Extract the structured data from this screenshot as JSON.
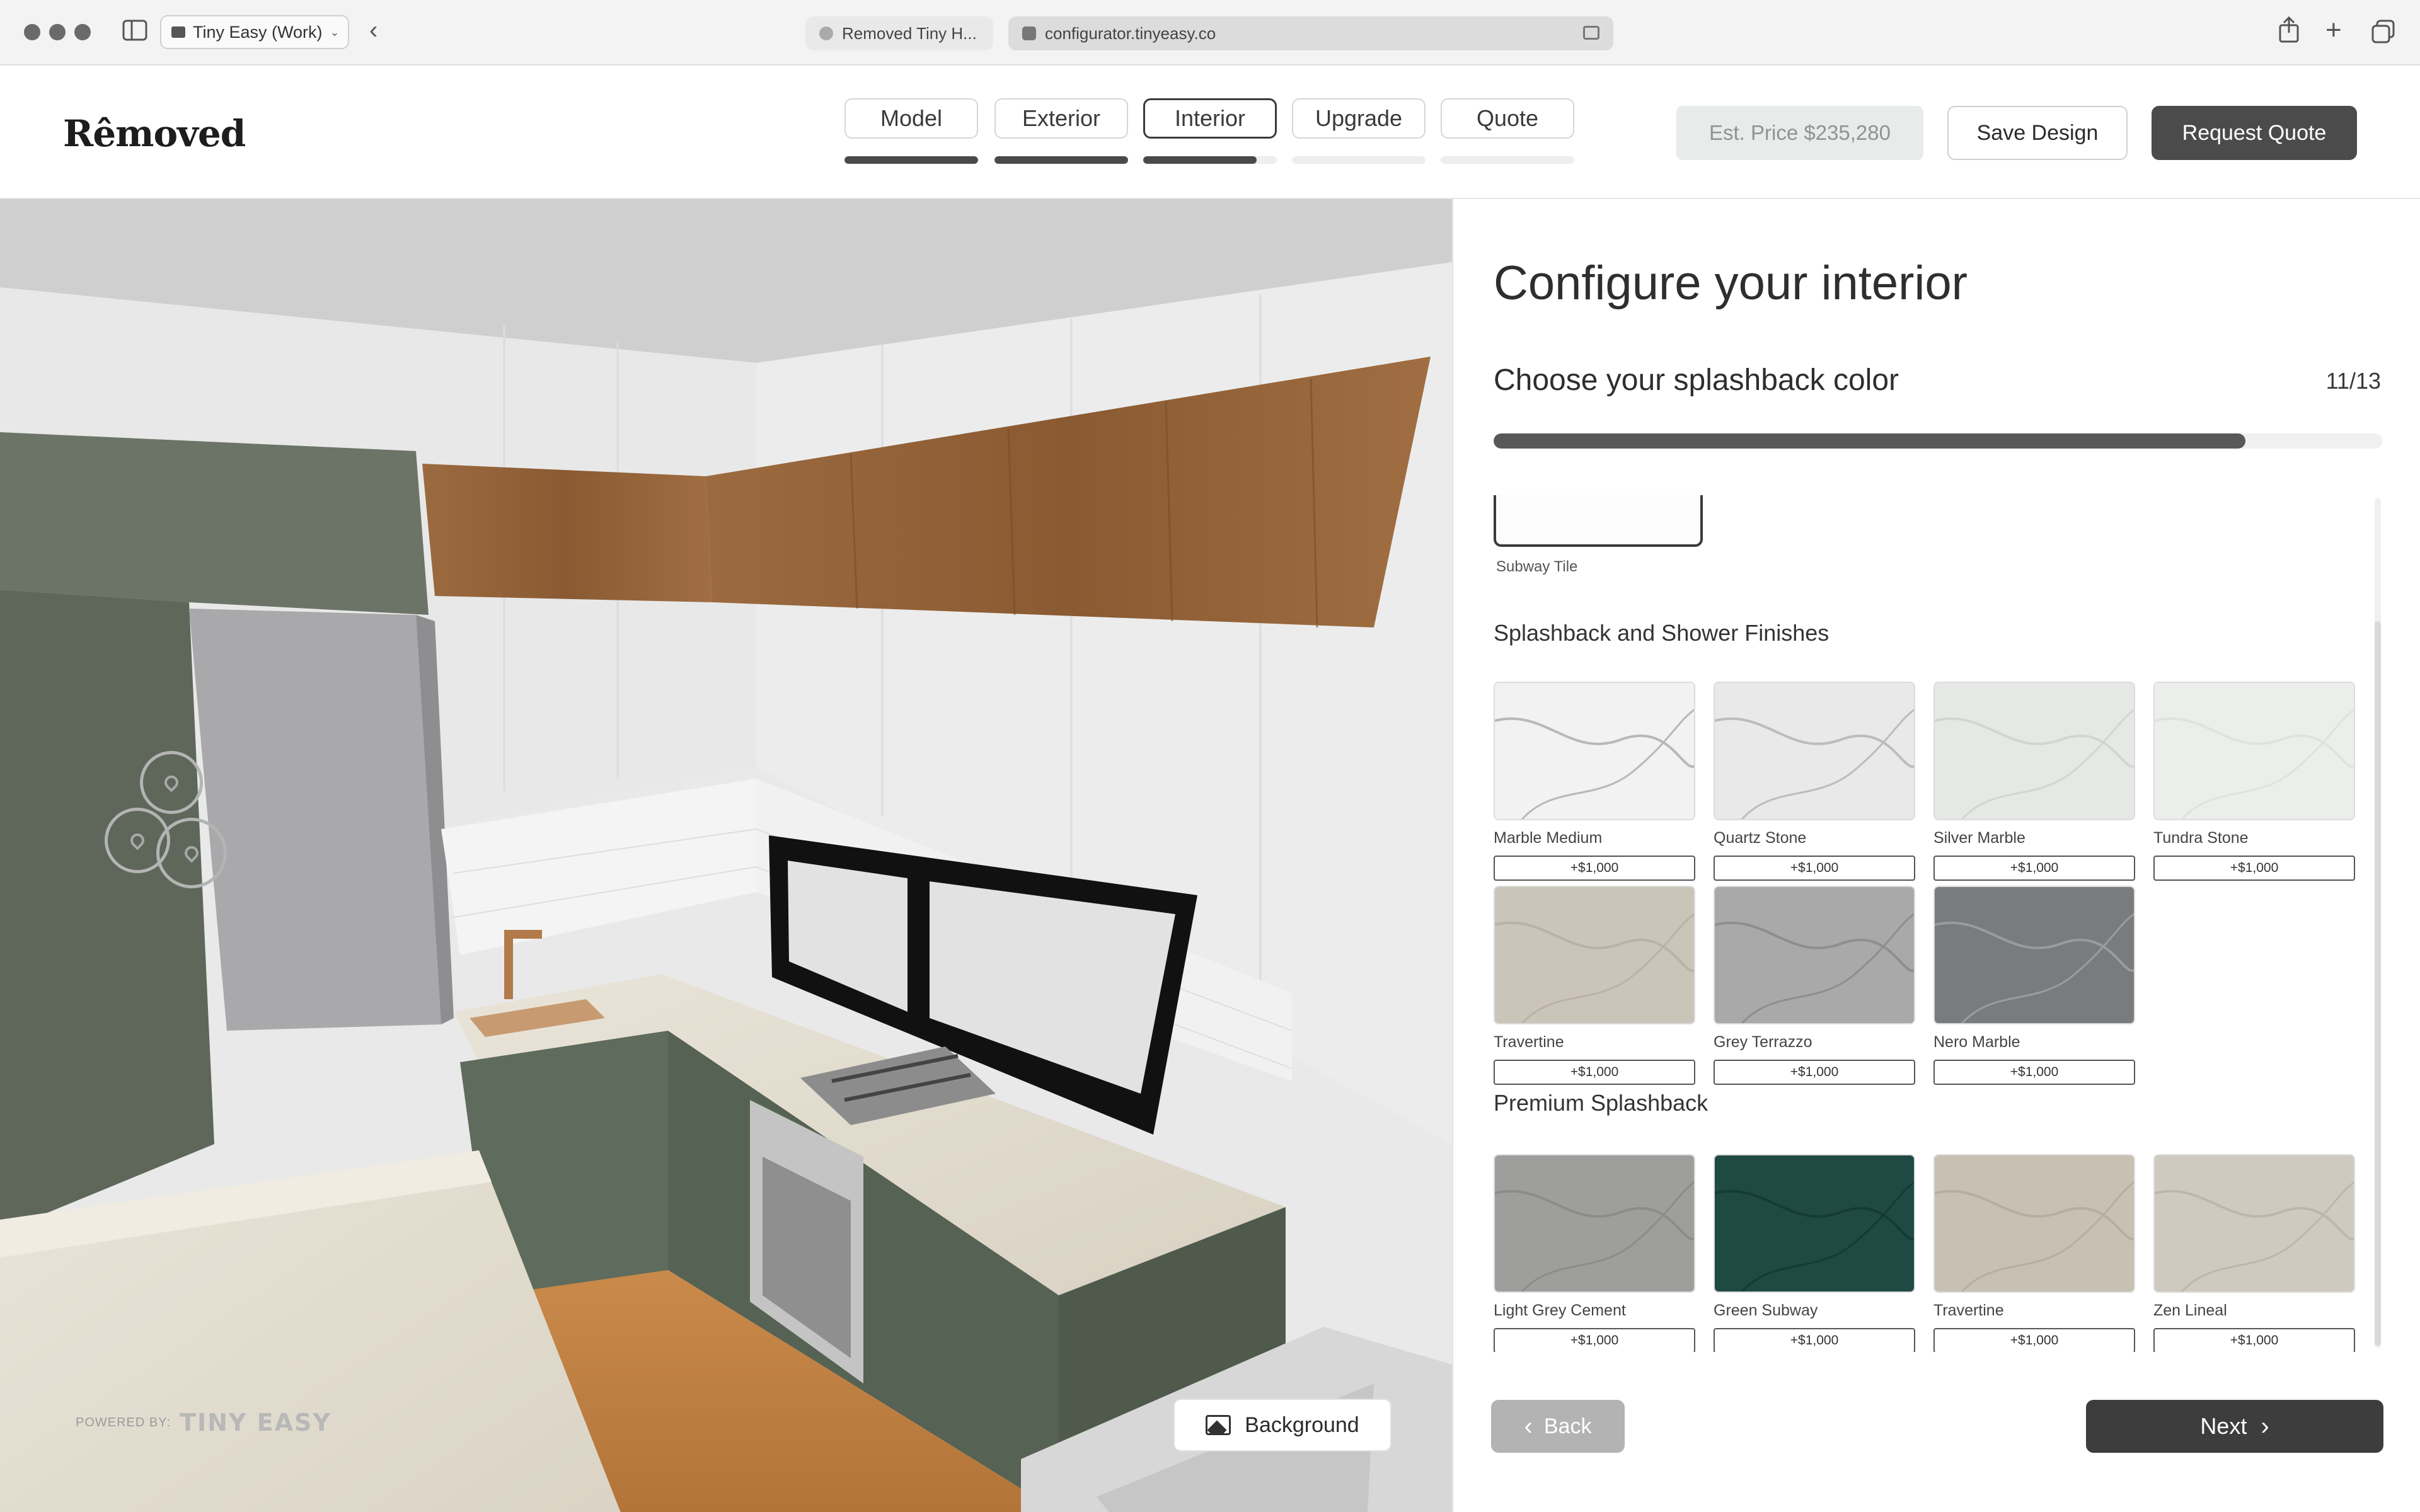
{
  "browser": {
    "profile_label": "Tiny Easy (Work)",
    "tabs": [
      {
        "label": "Removed Tiny H..."
      },
      {
        "label": "configurator.tinyeasy.co"
      }
    ],
    "icons": {
      "sidebar": "sidebar-icon",
      "back": "chevron-left-icon",
      "share": "share-icon",
      "new_tab": "plus-icon",
      "tab_overview": "tabs-icon"
    }
  },
  "header": {
    "logo": "Rêmoved",
    "steps": [
      {
        "label": "Model",
        "progress": 1.0
      },
      {
        "label": "Exterior",
        "progress": 1.0
      },
      {
        "label": "Interior",
        "progress": 0.85
      },
      {
        "label": "Upgrade",
        "progress": 0.0
      },
      {
        "label": "Quote",
        "progress": 0.0
      }
    ],
    "active_step": "Interior",
    "price": "Est. Price $235,280",
    "save_label": "Save Design",
    "quote_label": "Request Quote"
  },
  "preview": {
    "powered_by": "POWERED BY:",
    "powered_brand": "TINY EASY",
    "background_label": "Background",
    "hotspot_count": 3
  },
  "panel": {
    "title": "Configure your interior",
    "question": "Choose your splashback color",
    "step_count": "11/13",
    "progress": 0.846,
    "selected_partial": {
      "name": "Subway Tile"
    },
    "sections": [
      {
        "heading": "Splashback and Shower Finishes",
        "items": [
          {
            "name": "Marble Medium",
            "price": "+$1,000",
            "color": "#f2f2f2",
            "vein": "#b8b8b8"
          },
          {
            "name": "Quartz Stone",
            "price": "+$1,000",
            "color": "#e9e9e9",
            "vein": "#bcbcbc"
          },
          {
            "name": "Silver Marble",
            "price": "+$1,000",
            "color": "#e6e8e6",
            "vein": "#d2d6d2"
          },
          {
            "name": "Tundra Stone",
            "price": "+$1,000",
            "color": "#eceeec",
            "vein": "#dfe2df"
          },
          {
            "name": "Travertine",
            "price": "+$1,000",
            "color": "#cbc4b8",
            "vein": "#b9b2a6"
          },
          {
            "name": "Grey Terrazzo",
            "price": "+$1,000",
            "color": "#a9a9a9",
            "vein": "#8e8e8e"
          },
          {
            "name": "Nero Marble",
            "price": "+$1,000",
            "color": "#7a7b7e",
            "vein": "#9a9b9e"
          }
        ]
      },
      {
        "heading": "Premium Splashback",
        "items": [
          {
            "name": "Light Grey Cement",
            "price": "+$1,000",
            "color": "#9e9e9c",
            "vein": "#8c8c8a"
          },
          {
            "name": "Green Subway",
            "price": "+$1,000",
            "color": "#1f4a44",
            "vein": "#153a35"
          },
          {
            "name": "Travertine",
            "price": "+$1,000",
            "color": "#c8c0b3",
            "vein": "#b6ae9f"
          },
          {
            "name": "Zen Lineal",
            "price": "+$1,000",
            "color": "#cfcac0",
            "vein": "#bdb7ab"
          }
        ]
      }
    ],
    "back_label": "Back",
    "next_label": "Next"
  }
}
